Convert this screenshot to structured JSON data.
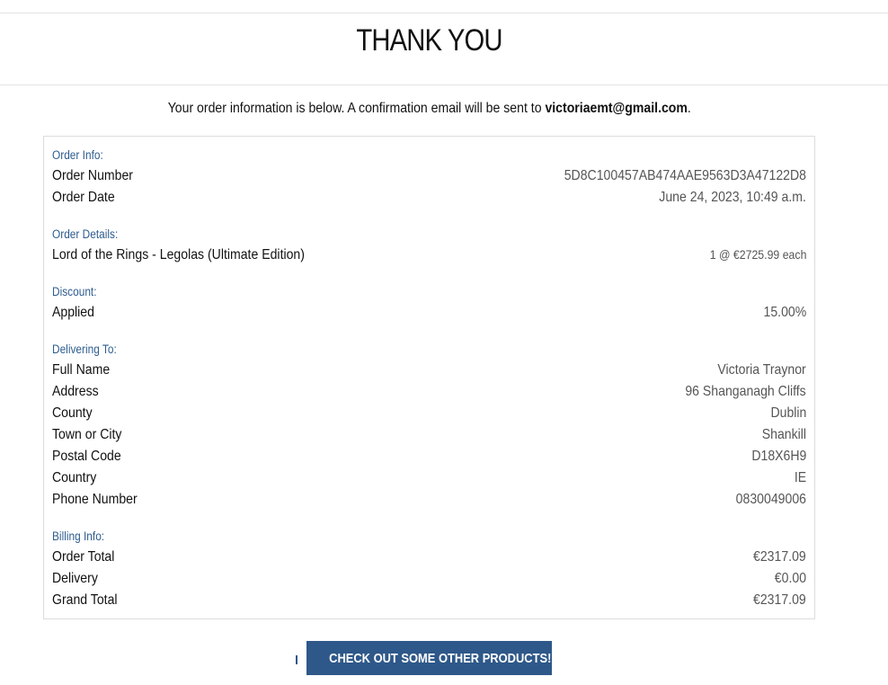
{
  "page": {
    "title": "THANK YOU",
    "intro_text": "Your order information is below. A confirmation email will be sent to ",
    "email": "victoriaemt@gmail.com",
    "intro_end": "."
  },
  "order_info": {
    "heading": "Order Info:",
    "number_label": "Order Number",
    "number_value": "5D8C100457AB474AAE9563D3A47122D8",
    "date_label": "Order Date",
    "date_value": "June 24, 2023, 10:49 a.m."
  },
  "order_details": {
    "heading": "Order Details:",
    "items": [
      {
        "name": "Lord of the Rings - Legolas (Ultimate Edition)",
        "qty_price": "1 @ €2725.99 each"
      }
    ]
  },
  "discount": {
    "heading": "Discount:",
    "label": "Applied",
    "value": "15.00%"
  },
  "delivering_to": {
    "heading": "Delivering To:",
    "rows": [
      {
        "label": "Full Name",
        "value": "Victoria Traynor"
      },
      {
        "label": "Address",
        "value": "96 Shanganagh Cliffs"
      },
      {
        "label": "County",
        "value": "Dublin"
      },
      {
        "label": "Town or City",
        "value": "Shankill"
      },
      {
        "label": "Postal Code",
        "value": "D18X6H9"
      },
      {
        "label": "Country",
        "value": "IE"
      },
      {
        "label": "Phone Number",
        "value": "0830049006"
      }
    ]
  },
  "billing": {
    "heading": "Billing Info:",
    "rows": [
      {
        "label": "Order Total",
        "value": "€2317.09"
      },
      {
        "label": "Delivery",
        "value": "€0.00"
      },
      {
        "label": "Grand Total",
        "value": "€2317.09"
      }
    ]
  },
  "cta": {
    "label": "Check Out Some Other Products!",
    "icon": "gift-icon"
  },
  "colors": {
    "accent": "#2e5889",
    "section_label": "#2f5d8f"
  }
}
